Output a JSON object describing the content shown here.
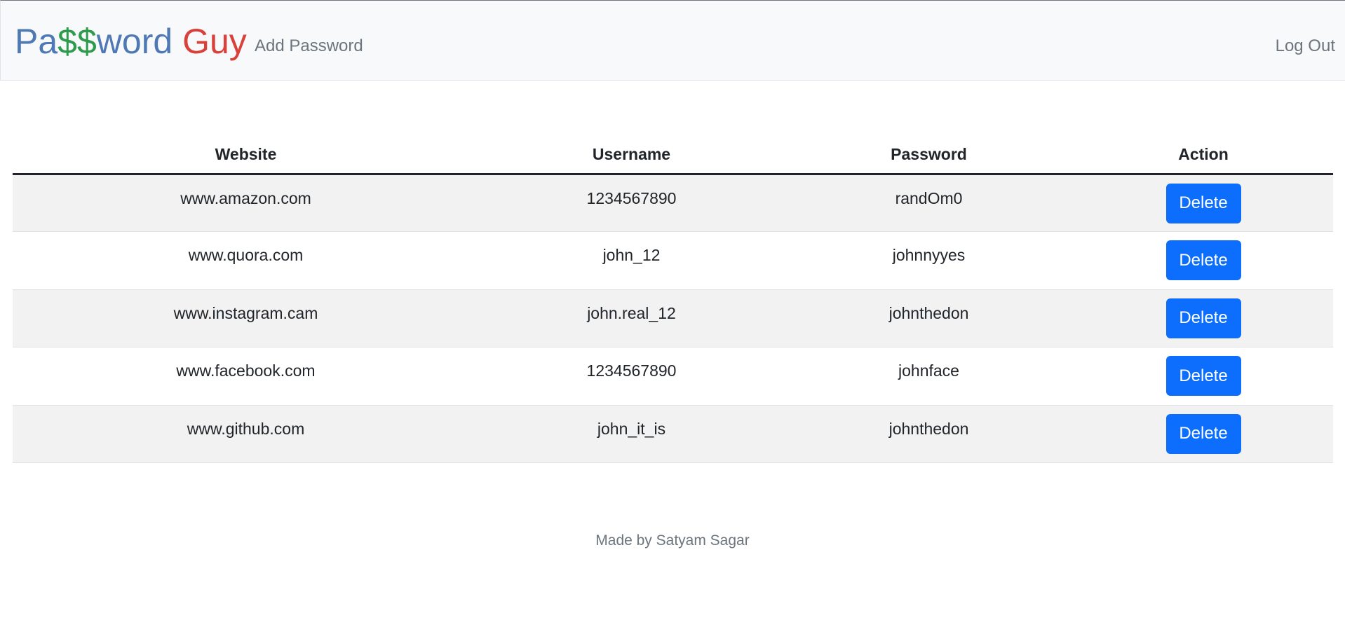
{
  "navbar": {
    "brand": {
      "part1": "Pa",
      "part2": "$$",
      "part3": "word",
      "part4": "Guy"
    },
    "add_password_label": "Add Password",
    "logout_label": "Log Out"
  },
  "table": {
    "headers": [
      "Website",
      "Username",
      "Password",
      "Action"
    ],
    "rows": [
      {
        "website": "www.amazon.com",
        "username": "1234567890",
        "password": "randOm0",
        "action": "Delete"
      },
      {
        "website": "www.quora.com",
        "username": "john_12",
        "password": "johnnyyes",
        "action": "Delete"
      },
      {
        "website": "www.instagram.cam",
        "username": "john.real_12",
        "password": "johnthedon",
        "action": "Delete"
      },
      {
        "website": "www.facebook.com",
        "username": "1234567890",
        "password": "johnface",
        "action": "Delete"
      },
      {
        "website": "www.github.com",
        "username": "john_it_is",
        "password": "johnthedon",
        "action": "Delete"
      }
    ]
  },
  "footer": {
    "text": "Made by Satyam Sagar"
  },
  "colors": {
    "brand_blue": "#4f79b4",
    "brand_green": "#2e9a4b",
    "brand_red": "#d9413a",
    "button_blue": "#0d6efd",
    "navbar_bg": "#f8f9fa",
    "stripe_bg": "#f2f2f2"
  }
}
